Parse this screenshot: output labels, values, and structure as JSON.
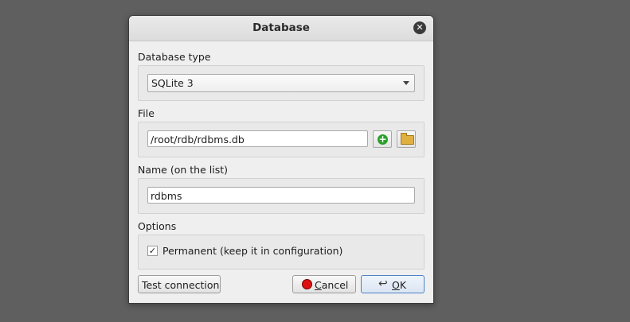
{
  "dialog": {
    "title": "Database",
    "close_symbol": "✕"
  },
  "database_type": {
    "label": "Database type",
    "selected": "SQLite 3"
  },
  "file": {
    "label": "File",
    "value": "/root/rdb/rdbms.db",
    "add_icon": "plus-icon",
    "browse_icon": "folder-icon"
  },
  "name": {
    "label": "Name (on the list)",
    "value": "rdbms"
  },
  "options": {
    "label": "Options",
    "permanent_label": "Permanent (keep it in configuration)",
    "permanent_checked": true,
    "check_mark": "✓"
  },
  "buttons": {
    "test_connection": "Test connection",
    "cancel_first": "C",
    "cancel_rest": "ancel",
    "ok_first": "O",
    "ok_rest": "K"
  }
}
